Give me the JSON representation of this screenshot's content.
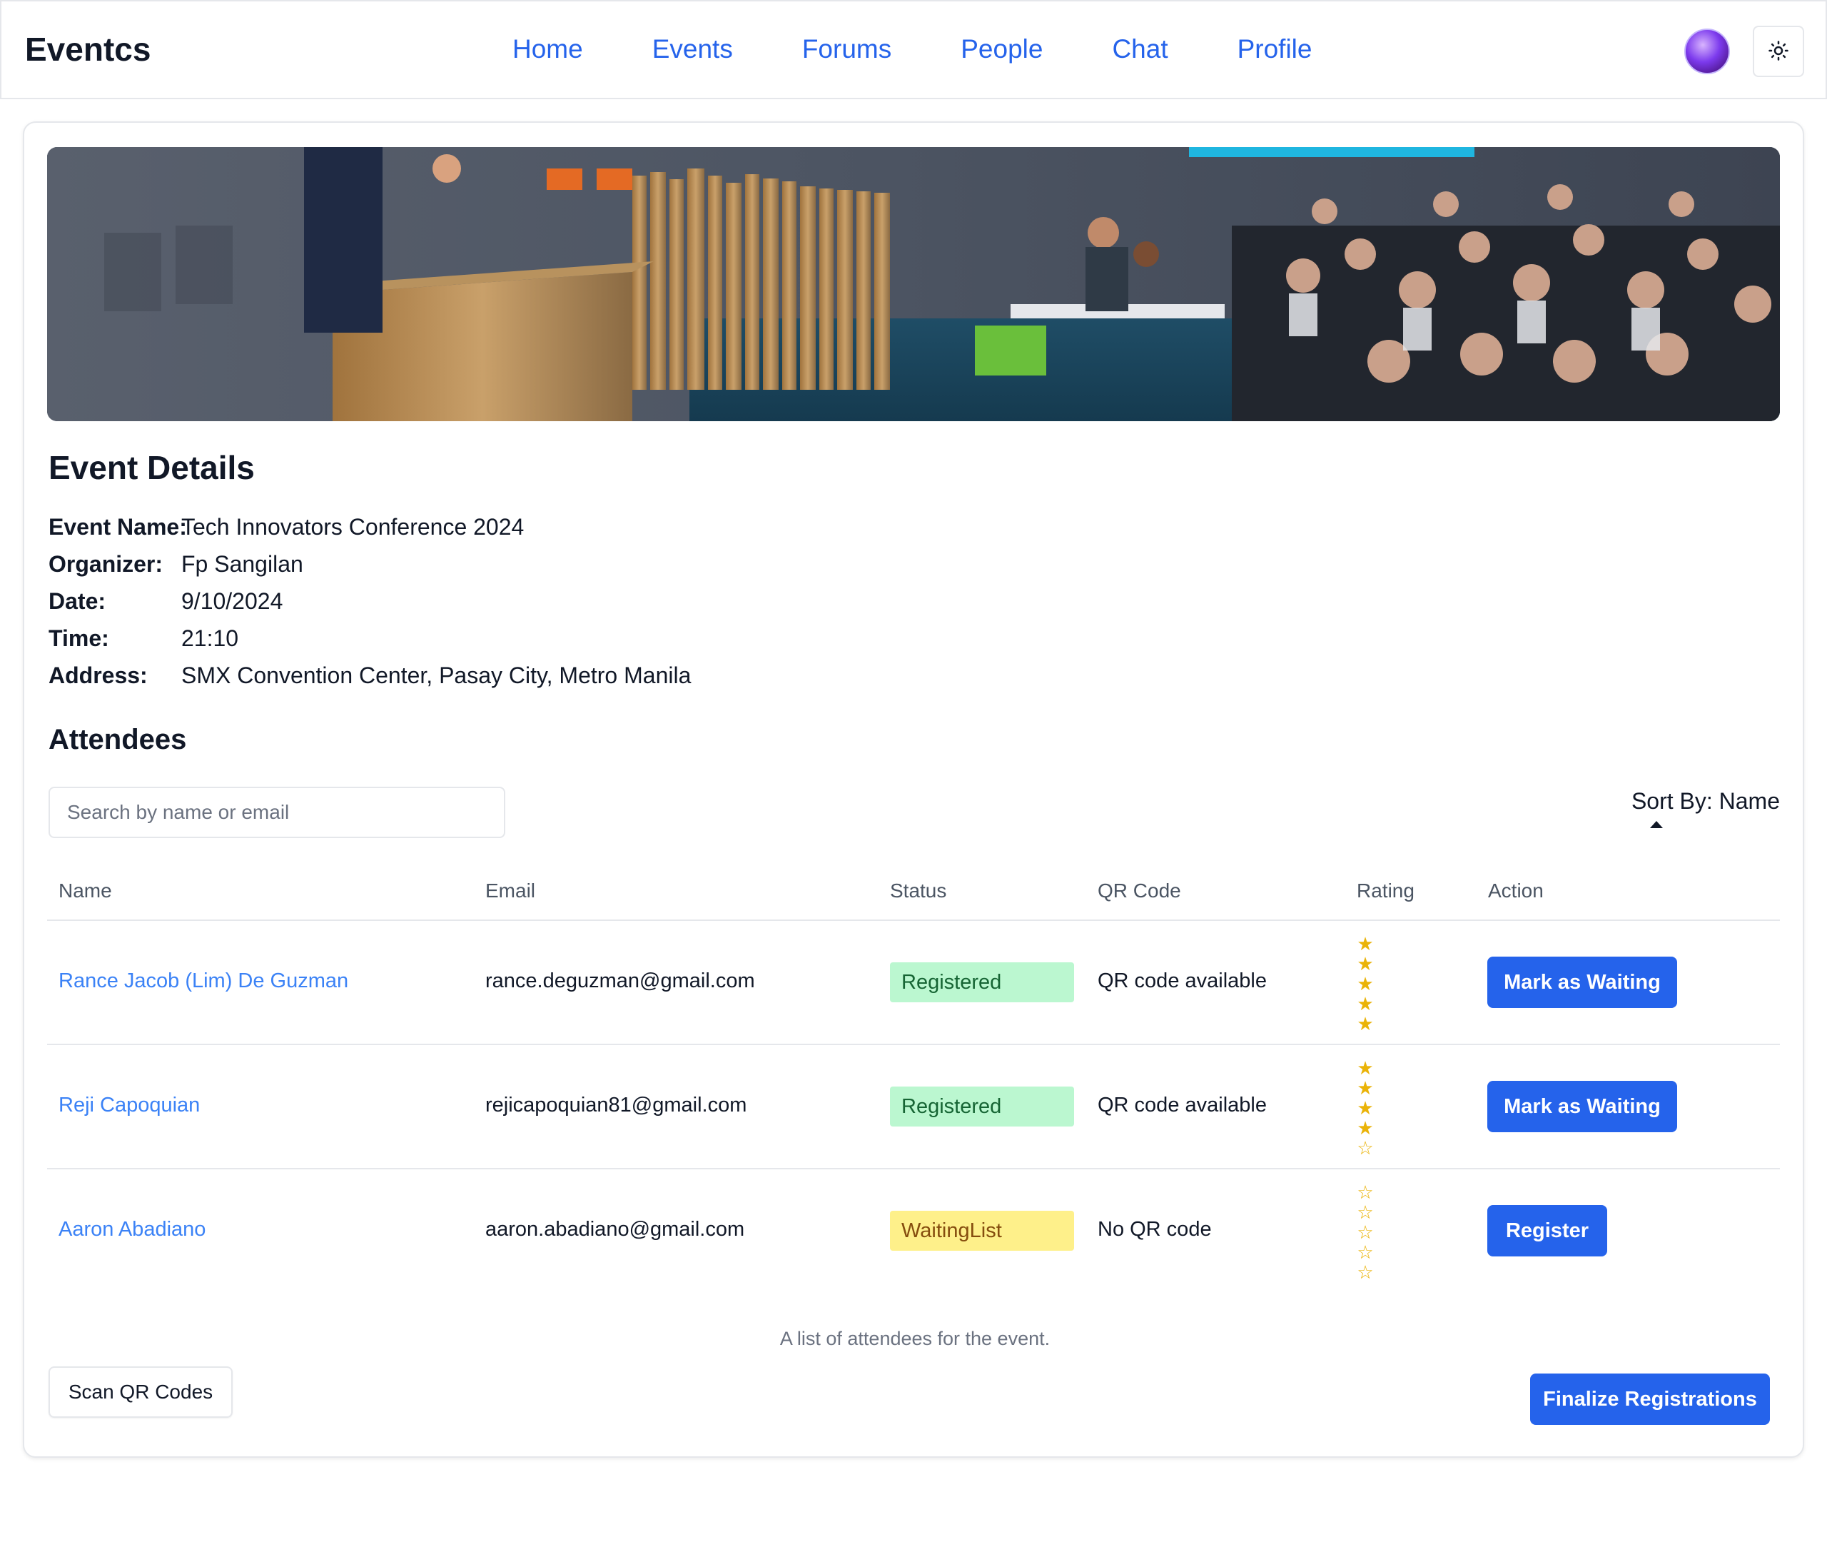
{
  "app": {
    "brand": "Eventcs",
    "nav": [
      "Home",
      "Events",
      "Forums",
      "People",
      "Chat",
      "Profile"
    ],
    "theme_icon": "sun-icon",
    "avatar_icon": "user-avatar"
  },
  "hero": {
    "image": "conference-speaker-audience-photo"
  },
  "event_details": {
    "title": "Event Details",
    "fields": [
      {
        "label": "Event Name:",
        "value": "Tech Innovators Conference 2024"
      },
      {
        "label": "Organizer:",
        "value": "Fp Sangilan"
      },
      {
        "label": "Date:",
        "value": "9/10/2024"
      },
      {
        "label": "Time:",
        "value": "21:10"
      },
      {
        "label": "Address:",
        "value": "SMX Convention Center, Pasay City, Metro Manila"
      }
    ]
  },
  "attendees": {
    "title": "Attendees",
    "search_placeholder": "Search by name or email",
    "sort_label": "Sort By: Name",
    "columns": [
      "Name",
      "Email",
      "Status",
      "QR Code",
      "Rating",
      "Action"
    ],
    "rows": [
      {
        "name": "Rance Jacob (Lim) De Guzman",
        "email": "rance.deguzman@gmail.com",
        "status": "Registered",
        "qr": "QR code available",
        "rating": 5,
        "action": "Mark as Waiting"
      },
      {
        "name": "Reji Capoquian",
        "email": "rejicapoquian81@gmail.com",
        "status": "Registered",
        "qr": "QR code available",
        "rating": 4,
        "action": "Mark as Waiting"
      },
      {
        "name": "Aaron Abadiano",
        "email": "aaron.abadiano@gmail.com",
        "status": "WaitingList",
        "qr": "No QR code",
        "rating": 0,
        "action": "Register"
      }
    ],
    "caption": "A list of attendees for the event.",
    "scan_button": "Scan QR Codes",
    "finalize_button": "Finalize Registrations"
  },
  "colors": {
    "primary": "#2563eb",
    "link": "#3b82f6",
    "registered_bg": "#bbf7d0",
    "waiting_bg": "#fef08a",
    "star": "#eab308"
  }
}
